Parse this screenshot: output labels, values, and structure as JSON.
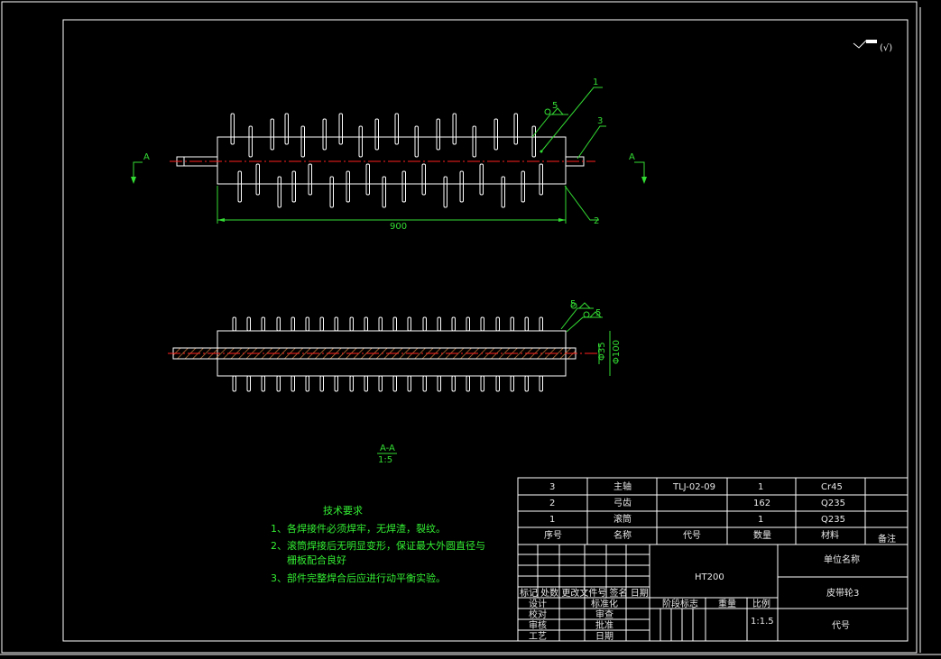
{
  "colors": {
    "background": "#000000",
    "outline": "#ffffff",
    "dimension": "#33dd33",
    "centerline": "#ff2020",
    "hatch": "#d08040"
  },
  "top_view": {
    "dimension_length": "900",
    "section_mark_left": "A",
    "section_mark_right": "A",
    "callouts": [
      "1",
      "2",
      "3"
    ],
    "weld_mark": "5"
  },
  "bottom_view": {
    "dim_inner": "Φ35",
    "dim_outer": "Φ100",
    "weld_marks": [
      "5",
      "5"
    ]
  },
  "section_label": {
    "name": "A-A",
    "scale": "1:5"
  },
  "corner_symbol": "(√)",
  "tech_requirements": {
    "title": "技术要求",
    "lines": [
      "1、各焊接件必须焊牢，无焊渣，裂纹。",
      "2、滚筒焊接后无明显变形，保证最大外圆直径与",
      "栅板配合良好",
      "3、部件完整焊合后应进行动平衡实验。"
    ]
  },
  "parts_list": {
    "rows": [
      {
        "no": "3",
        "name": "主轴",
        "code": "TLJ-02-09",
        "qty": "1",
        "material": "Cr45",
        "note": ""
      },
      {
        "no": "2",
        "name": "弓齿",
        "code": "",
        "qty": "162",
        "material": "Q235",
        "note": ""
      },
      {
        "no": "1",
        "name": "滚筒",
        "code": "",
        "qty": "1",
        "material": "Q235",
        "note": ""
      }
    ],
    "header": {
      "no": "序号",
      "name": "名称",
      "code": "代号",
      "qty": "数量",
      "material": "材料",
      "note": "备注"
    }
  },
  "title_block": {
    "material": "HT200",
    "unit_name": "单位名称",
    "drawing_name": "皮带轮3",
    "code_label": "代号",
    "revision_header": "标记 处数 更改文件号 签名 日期",
    "design": "设计",
    "standardization": "标准化",
    "check": "校对",
    "review": "审核",
    "process": "工艺",
    "audit": "审查",
    "approve": "批准",
    "date": "日期",
    "stage_mark": "阶段标志",
    "weight": "重量",
    "scale_label": "比例",
    "scale_value": "1:1.5"
  }
}
